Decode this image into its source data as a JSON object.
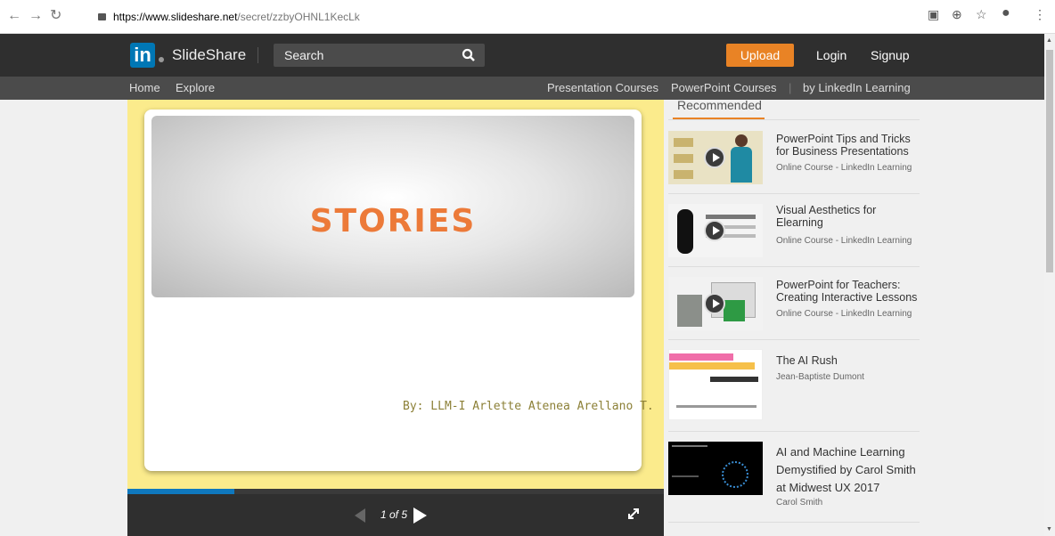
{
  "browser": {
    "url_host": "https://www.slideshare.net",
    "url_path": "/secret/zzbyOHNL1KecLk"
  },
  "header": {
    "logo_mark": "in",
    "logo_text": "SlideShare",
    "search_placeholder": "Search",
    "upload": "Upload",
    "login": "Login",
    "signup": "Signup"
  },
  "subnav": {
    "home": "Home",
    "explore": "Explore",
    "presentation_courses": "Presentation Courses",
    "powerpoint_courses": "PowerPoint Courses",
    "by_linkedin": "by LinkedIn Learning"
  },
  "slide": {
    "title": "STORIES",
    "author": "By: LLM-I  Arlette Atenea Arellano T."
  },
  "player": {
    "page_indicator": "1 of 5",
    "progress": 0.2
  },
  "sidebar": {
    "heading": "Recommended",
    "items": [
      {
        "title": "PowerPoint Tips and Tricks for Business Presentations",
        "subtitle": "Online Course - LinkedIn Learning"
      },
      {
        "title": "Visual Aesthetics for Elearning",
        "subtitle": "Online Course - LinkedIn Learning"
      },
      {
        "title": "PowerPoint for Teachers: Creating Interactive Lessons",
        "subtitle": "Online Course - LinkedIn Learning"
      },
      {
        "title": "The AI Rush",
        "subtitle": "Jean-Baptiste Dumont"
      },
      {
        "title": "AI and Machine Learning Demystified by Carol Smith at Midwest UX 2017",
        "subtitle": "Carol Smith"
      }
    ]
  },
  "colors": {
    "accent": "#e98325",
    "slide_title": "#ec7a39",
    "progress": "#0f78be",
    "slide_bg": "#fbeb8c"
  }
}
